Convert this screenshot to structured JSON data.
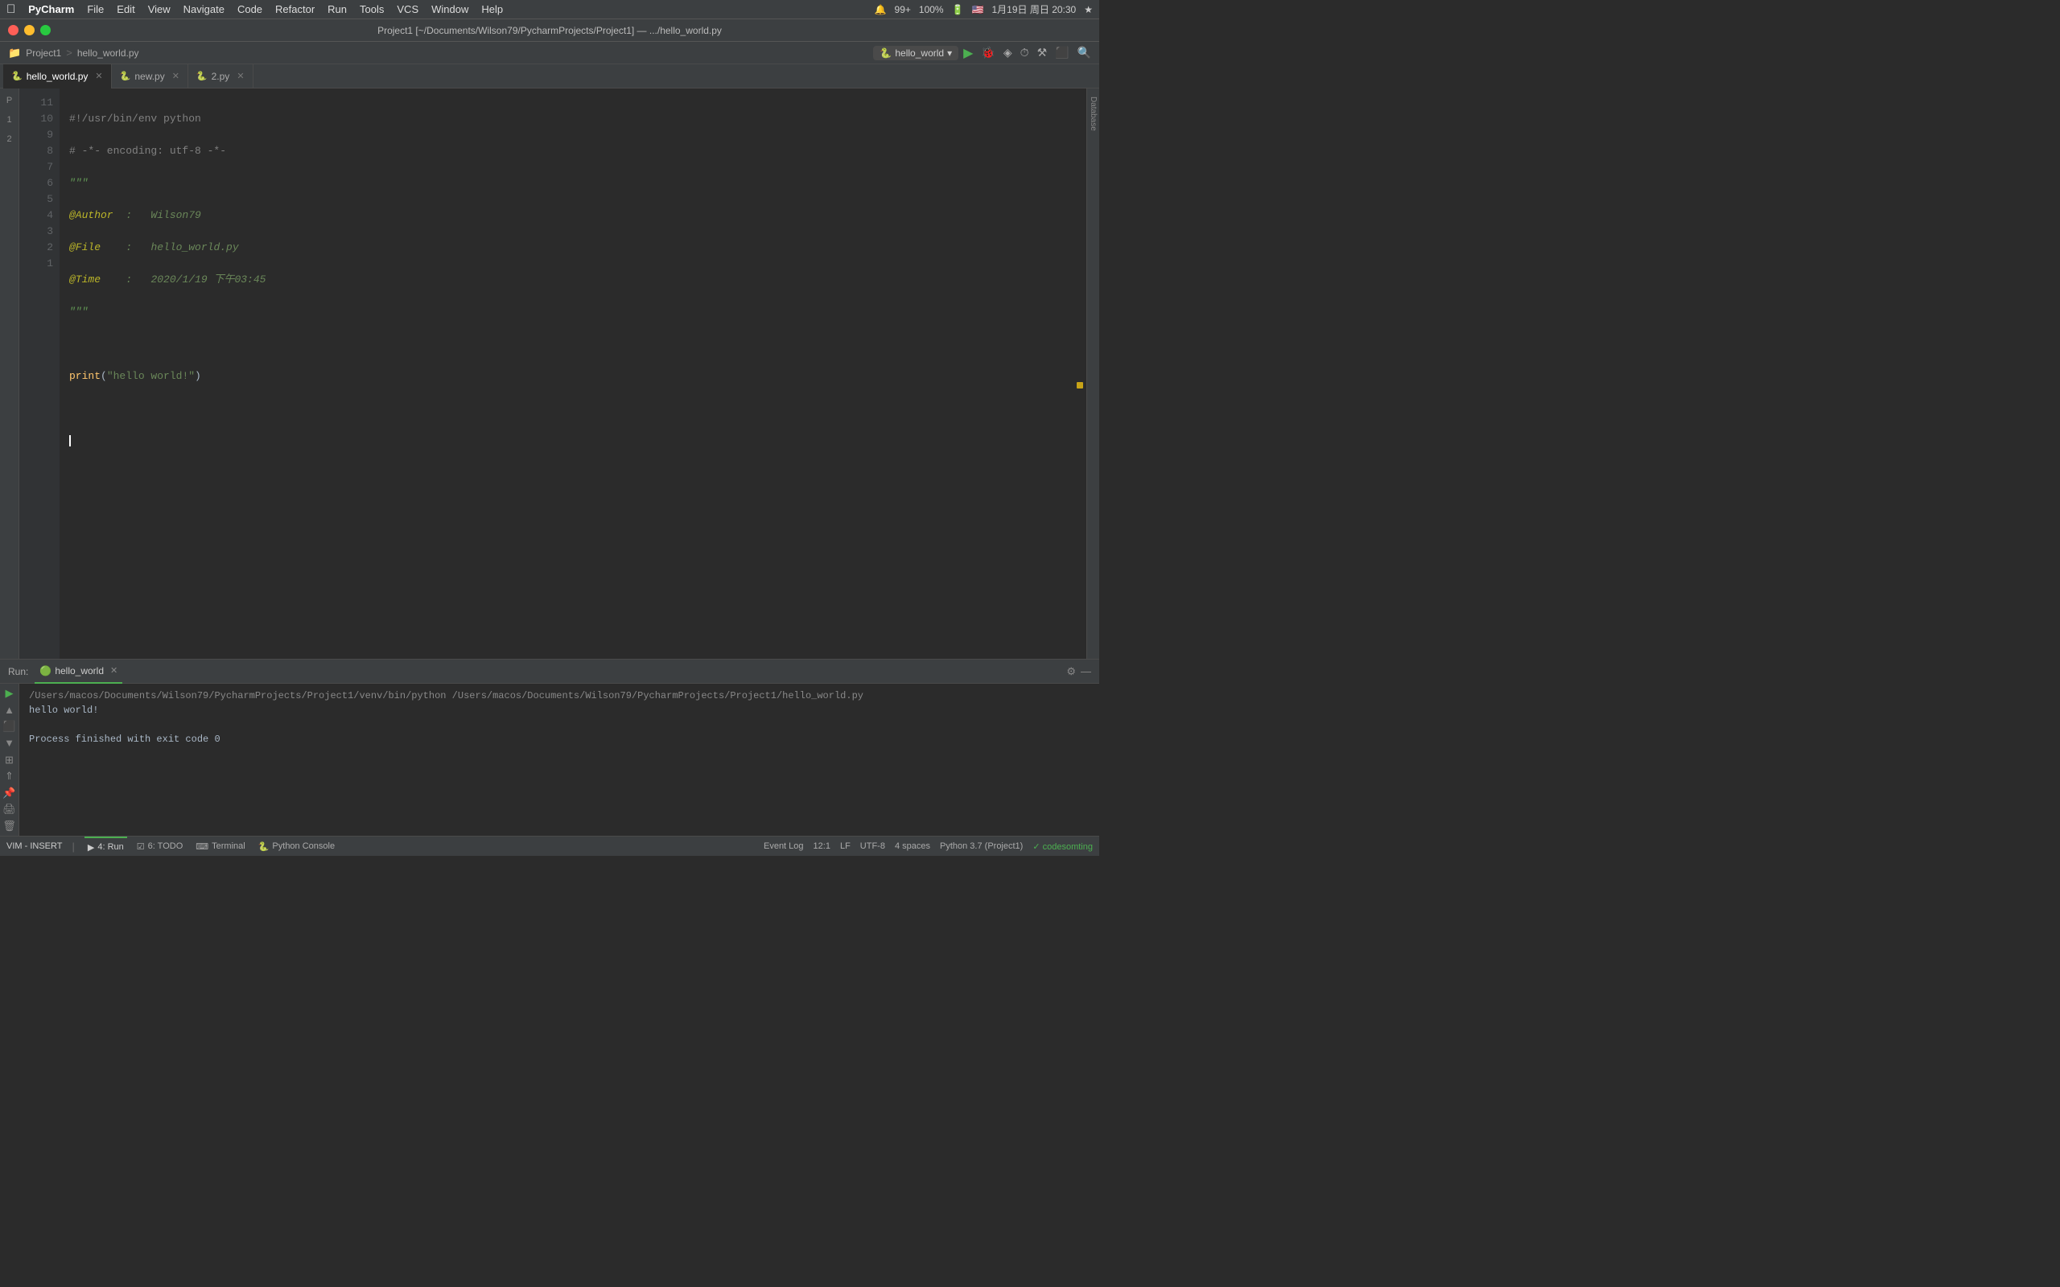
{
  "menubar": {
    "apple": "&#63743;",
    "app_name": "PyCharm",
    "items": [
      "File",
      "Edit",
      "View",
      "Navigate",
      "Code",
      "Refactor",
      "Run",
      "Tools",
      "VCS",
      "Window",
      "Help"
    ],
    "right": {
      "bell": "🔔",
      "notif": "99+",
      "battery_pct": "100%",
      "battery_icon": "🔋",
      "flag": "🇺🇸",
      "datetime": "1月19日 周日 20:30",
      "star": "★"
    }
  },
  "titlebar": {
    "title": "Project1 [~/Documents/Wilson79/PycharmProjects/Project1] — .../hello_world.py"
  },
  "project_bar": {
    "folder_icon": "📁",
    "project": "Project1",
    "separator": ">",
    "file": "hello_world.py",
    "run_config": "hello_world",
    "run_icon": "▶",
    "search_icon": "🔍"
  },
  "tabs": [
    {
      "label": "hello_world.py",
      "icon": "🐍",
      "active": true,
      "closable": true
    },
    {
      "label": "new.py",
      "icon": "🐍",
      "active": false,
      "closable": true
    },
    {
      "label": "2.py",
      "icon": "🐍",
      "active": false,
      "closable": true
    }
  ],
  "code": {
    "lines": [
      {
        "num": 11,
        "content": "#!/usr/bin/env python",
        "type": "shebang"
      },
      {
        "num": 10,
        "content": "# -*- encoding: utf-8 -*-",
        "type": "comment"
      },
      {
        "num": 9,
        "content": "\"\"\"",
        "type": "docstring"
      },
      {
        "num": 8,
        "content": "@Author  :   Wilson79",
        "type": "decorator"
      },
      {
        "num": 7,
        "content": "@File    :   hello_world.py",
        "type": "decorator"
      },
      {
        "num": 6,
        "content": "@Time    :   2020/1/19 下午03:45",
        "type": "decorator"
      },
      {
        "num": 5,
        "content": "\"\"\"",
        "type": "docstring"
      },
      {
        "num": 4,
        "content": "",
        "type": "empty"
      },
      {
        "num": 3,
        "content": "print(\"hello world!\")",
        "type": "code"
      },
      {
        "num": 2,
        "content": "",
        "type": "empty"
      },
      {
        "num": 1,
        "content": "",
        "type": "cursor"
      }
    ]
  },
  "run_panel": {
    "label": "Run:",
    "tab_icon": "🟢",
    "tab_label": "hello_world",
    "cmd": "/Users/macos/Documents/Wilson79/PycharmProjects/Project1/venv/bin/python /Users/macos/Documents/Wilson79/PycharmProjects/Project1/hello_world.py",
    "output_line1": "hello world!",
    "output_line2": "",
    "output_line3": "Process finished with exit code 0"
  },
  "bottom_bar": {
    "vim_status": "VIM - INSERT",
    "run_icon": "▶",
    "run_label": "4: Run",
    "todo_icon": "☑",
    "todo_label": "6: TODO",
    "terminal_icon": "⌨",
    "terminal_label": "Terminal",
    "console_icon": "🐍",
    "console_label": "Python Console",
    "position": "12:1",
    "line_sep": "LF",
    "encoding": "UTF-8",
    "indent": "4 spaces",
    "python_ver": "Python 3.7 (Project1)",
    "event_log": "Event Log",
    "git_status": "✓ codesomting"
  }
}
